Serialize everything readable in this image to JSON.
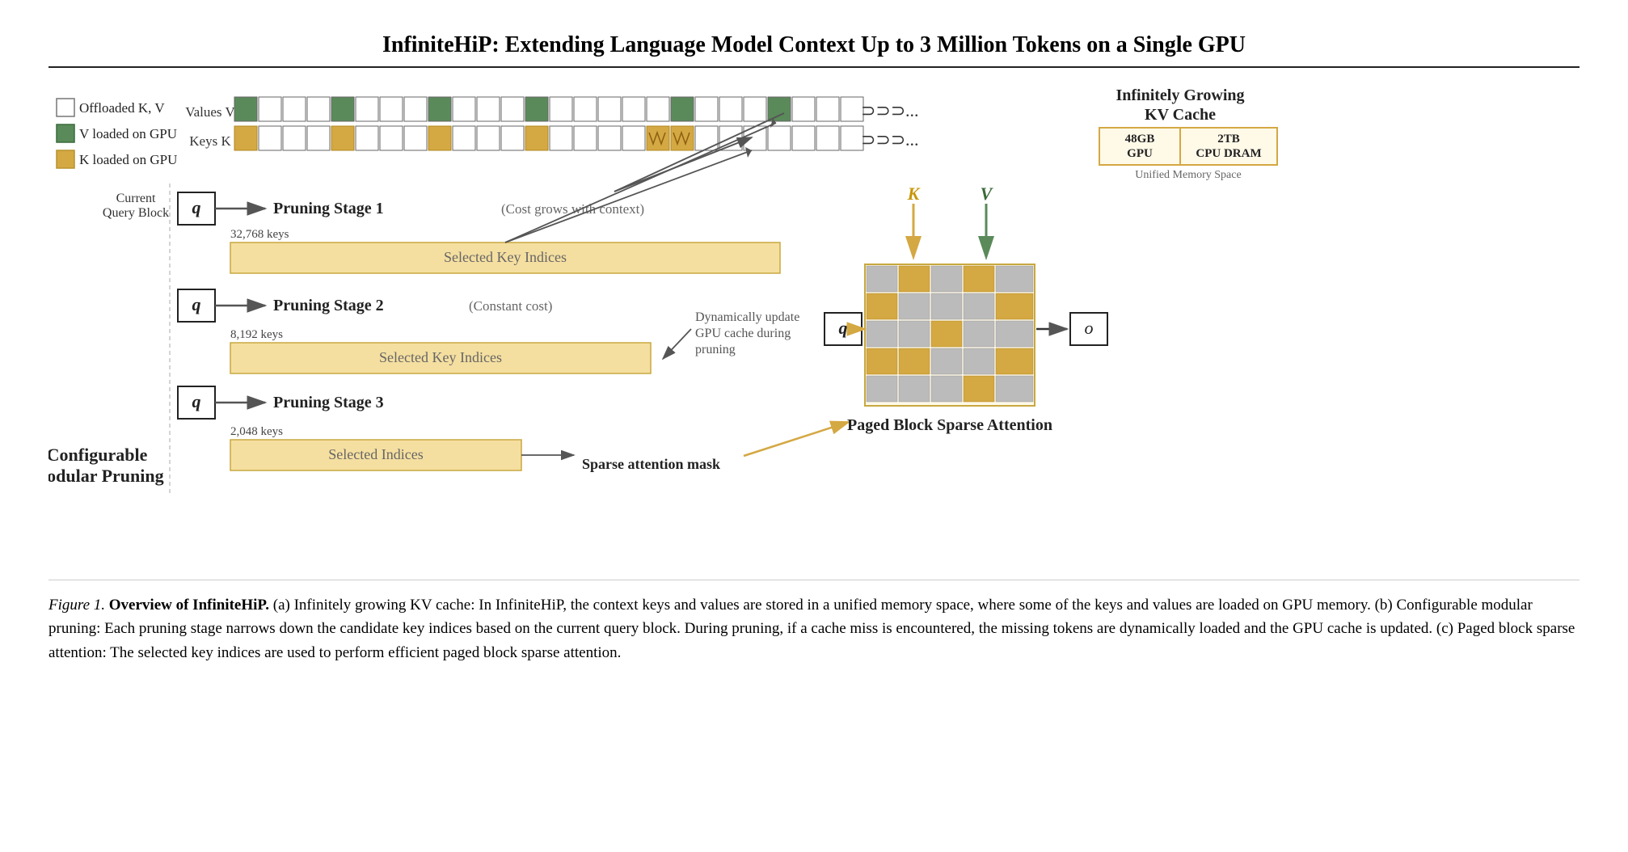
{
  "title": "InfiniteHiP: Extending Language Model Context Up to 3 Million Tokens on a Single GPU",
  "legend": {
    "items": [
      {
        "label": "Offloaded K, V",
        "color": "white"
      },
      {
        "label": "V loaded on GPU",
        "color": "green"
      },
      {
        "label": "K loaded on GPU",
        "color": "gold"
      }
    ]
  },
  "kvCache": {
    "valuesLabel": "Values V",
    "keysLabel": "Keys K"
  },
  "rightPanel": {
    "title": "Infinitely Growing\nKV Cache",
    "gpu": "48GB\nGPU",
    "cpu": "2TB\nCPU DRAM",
    "unified": "Unified Memory Space"
  },
  "pruning": {
    "currentQueryLabel": "Current\nQuery Block",
    "stages": [
      {
        "id": 1,
        "title": "Pruning Stage 1",
        "subtitle": "(Cost grows with context)",
        "keysCount": "32,768 keys",
        "barLabel": "Selected Key Indices"
      },
      {
        "id": 2,
        "title": "Pruning Stage 2",
        "subtitle": "(Constant cost)",
        "keysCount": "8,192 keys",
        "barLabel": "Selected Key Indices"
      },
      {
        "id": 3,
        "title": "Pruning Stage 3",
        "subtitle": "",
        "keysCount": "2,048 keys",
        "barLabel": "Selected Indices"
      }
    ],
    "dynamicUpdateLabel": "Dynamically update\nGPU cache during\npruning",
    "sparseLabel": "Sparse attention mask"
  },
  "sparse": {
    "title": "Paged Block Sparse Attention",
    "kLabel": "K",
    "vLabel": "V",
    "qLabel": "q",
    "oLabel": "o"
  },
  "modulePruning": {
    "title": "Configurable\nModular Pruning"
  },
  "caption": {
    "figureLabel": "Figure 1.",
    "boldPart": "Overview of InfiniteHiP.",
    "text": " (a) Infinitely growing KV cache: In InfiniteHiP, the context keys and values are stored in a unified memory space, where some of the keys and values are loaded on GPU memory. (b) Configurable modular pruning: Each pruning stage narrows down the candidate key indices based on the current query block. During pruning, if a cache miss is encountered, the missing tokens are dynamically loaded and the GPU cache is updated. (c) Paged block sparse attention: The selected key indices are used to perform efficient paged block sparse attention."
  }
}
